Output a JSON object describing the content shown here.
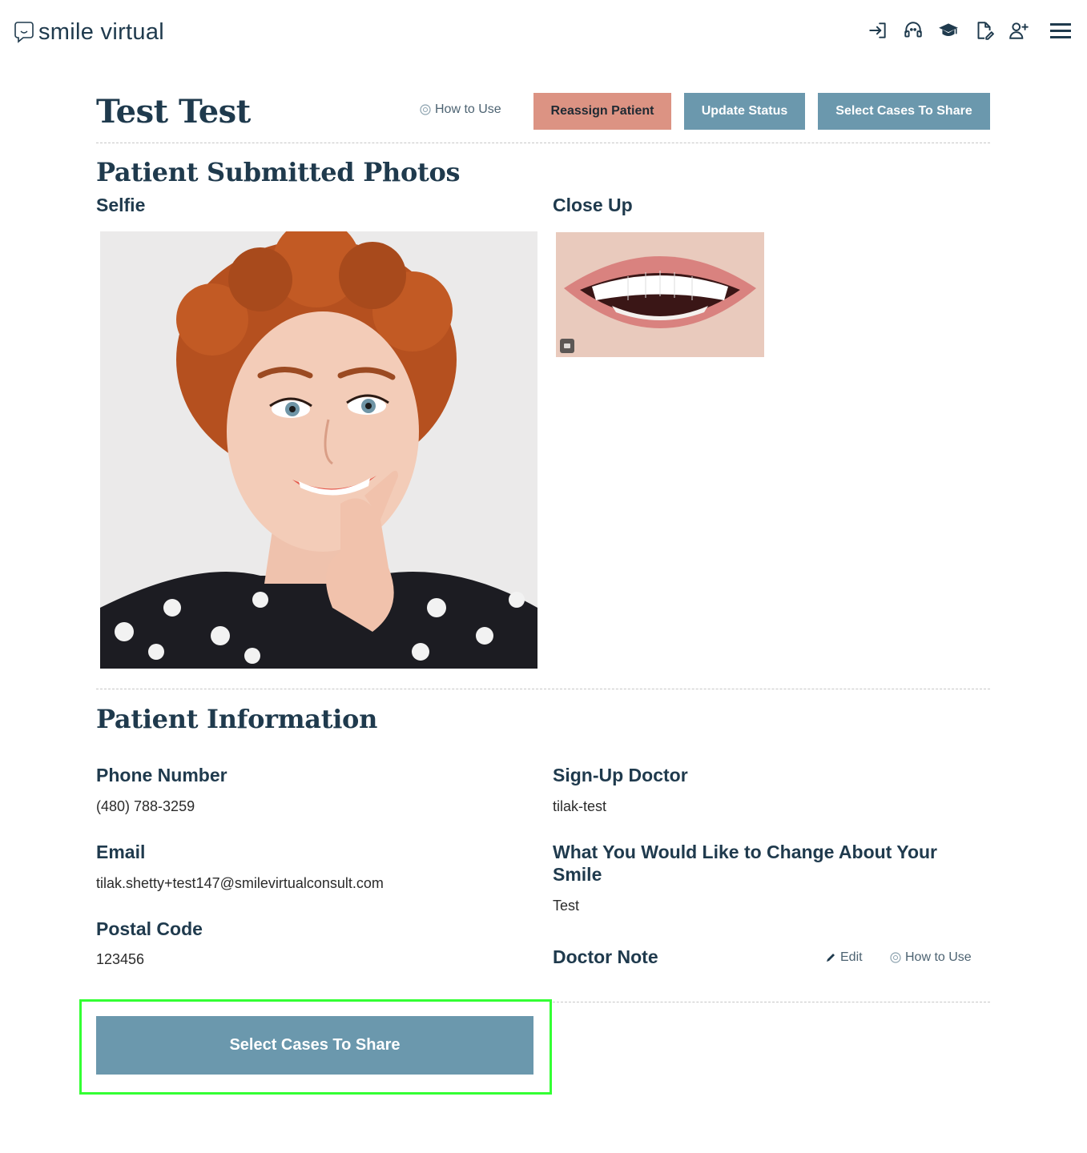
{
  "header": {
    "logo_text": "smile virtual",
    "icons": [
      "login-icon",
      "support-agent-icon",
      "graduation-cap-icon",
      "document-edit-icon",
      "add-user-icon",
      "hamburger-menu-icon"
    ]
  },
  "patient": {
    "name": "Test Test",
    "how_to_use": "How to Use",
    "reassign_label": "Reassign Patient",
    "update_status_label": "Update Status",
    "select_cases_label": "Select Cases To Share"
  },
  "photos": {
    "title": "Patient Submitted Photos",
    "selfie_label": "Selfie",
    "closeup_label": "Close Up"
  },
  "info": {
    "title": "Patient Information",
    "phone_label": "Phone Number",
    "phone_value": "(480) 788-3259",
    "email_label": "Email",
    "email_value": "tilak.shetty+test147@smilevirtualconsult.com",
    "postal_label": "Postal Code",
    "postal_value": "123456",
    "doctor_label": "Sign-Up Doctor",
    "doctor_value": "tilak-test",
    "change_label": "What You Would Like to Change About Your Smile",
    "change_value": "Test",
    "note_label": "Doctor Note",
    "note_edit": "Edit",
    "note_how_to_use": "How to Use"
  },
  "footer": {
    "select_cases_label": "Select Cases To Share"
  },
  "colors": {
    "primary": "#6b98ad",
    "reassign": "#dc9383",
    "text_dark": "#1f3a4d",
    "highlight": "#33ff33"
  }
}
